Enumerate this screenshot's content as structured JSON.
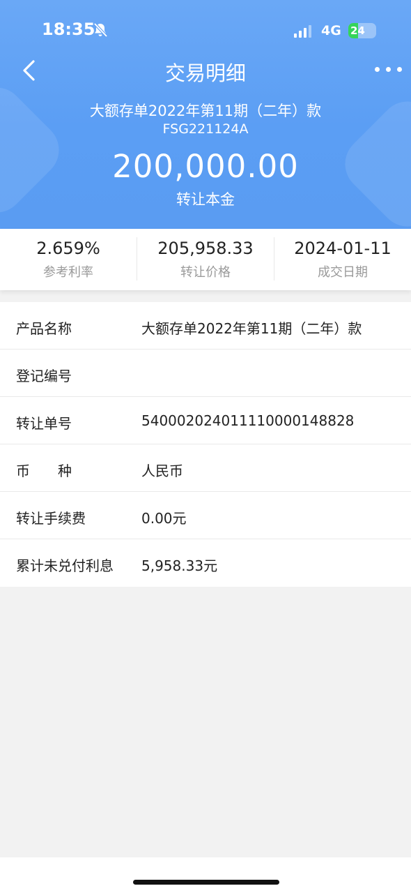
{
  "status_bar": {
    "time": "18:35",
    "network": "4G",
    "battery": "24"
  },
  "nav": {
    "title": "交易明细"
  },
  "product": {
    "name": "大额存单2022年第11期（二年）款",
    "code": "FSG221124A",
    "principal": "200,000.00",
    "principal_label": "转让本金"
  },
  "stats": [
    {
      "value": "2.659%",
      "label": "参考利率"
    },
    {
      "value": "205,958.33",
      "label": "转让价格"
    },
    {
      "value": "2024-01-11",
      "label": "成交日期"
    }
  ],
  "details": [
    {
      "key": "产品名称",
      "value": "大额存单2022年第11期（二年）款"
    },
    {
      "key": "登记编号",
      "value": ""
    },
    {
      "key": "转让单号",
      "value": "540002024011110000148828"
    },
    {
      "key": "币　　种",
      "value": "人民币"
    },
    {
      "key": "转让手续费",
      "value": "0.00元"
    },
    {
      "key": "累计未兑付利息",
      "value": "5,958.33元"
    }
  ],
  "colors": {
    "header_blue": "#5b9ef4",
    "battery_green": "#35d45a",
    "page_bg": "#f2f2f2"
  }
}
